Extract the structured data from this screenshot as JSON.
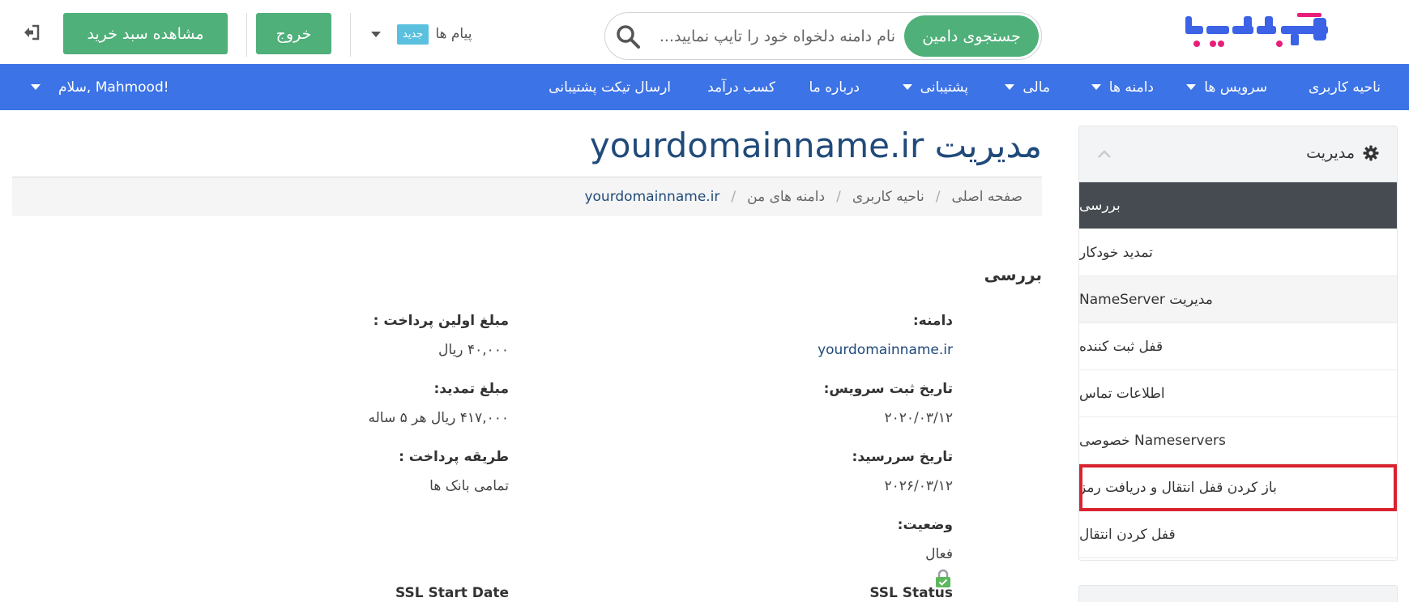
{
  "header": {
    "logo_text": "آسانرایان",
    "search": {
      "button_label": "جستجوی دامین",
      "placeholder": "نام دامنه دلخواه خود را تایپ نمایید..."
    },
    "messages": {
      "label": "پیام ها",
      "badge": "جدید"
    },
    "logout_label": "خروج",
    "cart_label": "مشاهده سبد خرید"
  },
  "nav": {
    "items": [
      {
        "label": "ناحیه کاربری",
        "dropdown": false
      },
      {
        "label": "سرویس ها",
        "dropdown": true
      },
      {
        "label": "دامنه ها",
        "dropdown": true
      },
      {
        "label": "مالی",
        "dropdown": true
      },
      {
        "label": "پشتیبانی",
        "dropdown": true
      },
      {
        "label": "درباره ما",
        "dropdown": false
      },
      {
        "label": "کسب درآمد",
        "dropdown": false
      },
      {
        "label": "ارسال تیکت پشتیبانی",
        "dropdown": false
      }
    ],
    "greeting": "سلام, Mahmood!"
  },
  "sidebar": {
    "title": "مدیریت",
    "items": [
      {
        "label": "بررسی",
        "state": "active"
      },
      {
        "label": "تمدید خودکار",
        "state": ""
      },
      {
        "label": "مدیریت NameServer",
        "state": "light"
      },
      {
        "label": "قفل ثبت کننده",
        "state": ""
      },
      {
        "label": "اطلاعات تماس",
        "state": ""
      },
      {
        "label": "Nameservers خصوصی",
        "state": ""
      },
      {
        "label": "باز کردن قفل انتقال و دریافت رمز",
        "state": "highlight"
      },
      {
        "label": "قفل کردن انتقال",
        "state": ""
      }
    ]
  },
  "main": {
    "title": "مدیریت yourdomainname.ir",
    "breadcrumb": [
      "صفحه اصلی",
      "ناحیه کاربری",
      "دامنه های من",
      "yourdomainname.ir"
    ],
    "section_title": "بررسی",
    "fields_right": [
      {
        "label": "دامنه:",
        "value": "yourdomainname.ir",
        "link": true
      },
      {
        "label": "تاریخ ثبت سرویس:",
        "value": "۲۰۲۰/۰۳/۱۲"
      },
      {
        "label": "تاریخ سررسید:",
        "value": "۲۰۲۶/۰۳/۱۲"
      },
      {
        "label": "وضعیت:",
        "value": "فعال"
      }
    ],
    "fields_left": [
      {
        "label": "مبلغ اولین پرداخت :",
        "value": "۴۰,۰۰۰ ریال"
      },
      {
        "label": "مبلغ تمدید:",
        "value": "۴۱۷,۰۰۰ ریال هر ۵ ساله"
      },
      {
        "label": "طریقه پرداخت :",
        "value": "تمامی بانک ها"
      }
    ],
    "ssl_status_label": "SSL Status",
    "ssl_start_label": "SSL Start Date"
  },
  "colors": {
    "nav_bg": "#3c73e6",
    "button_green": "#4fb07a",
    "title_blue": "#204a7a",
    "highlight_red": "#d9232e"
  }
}
